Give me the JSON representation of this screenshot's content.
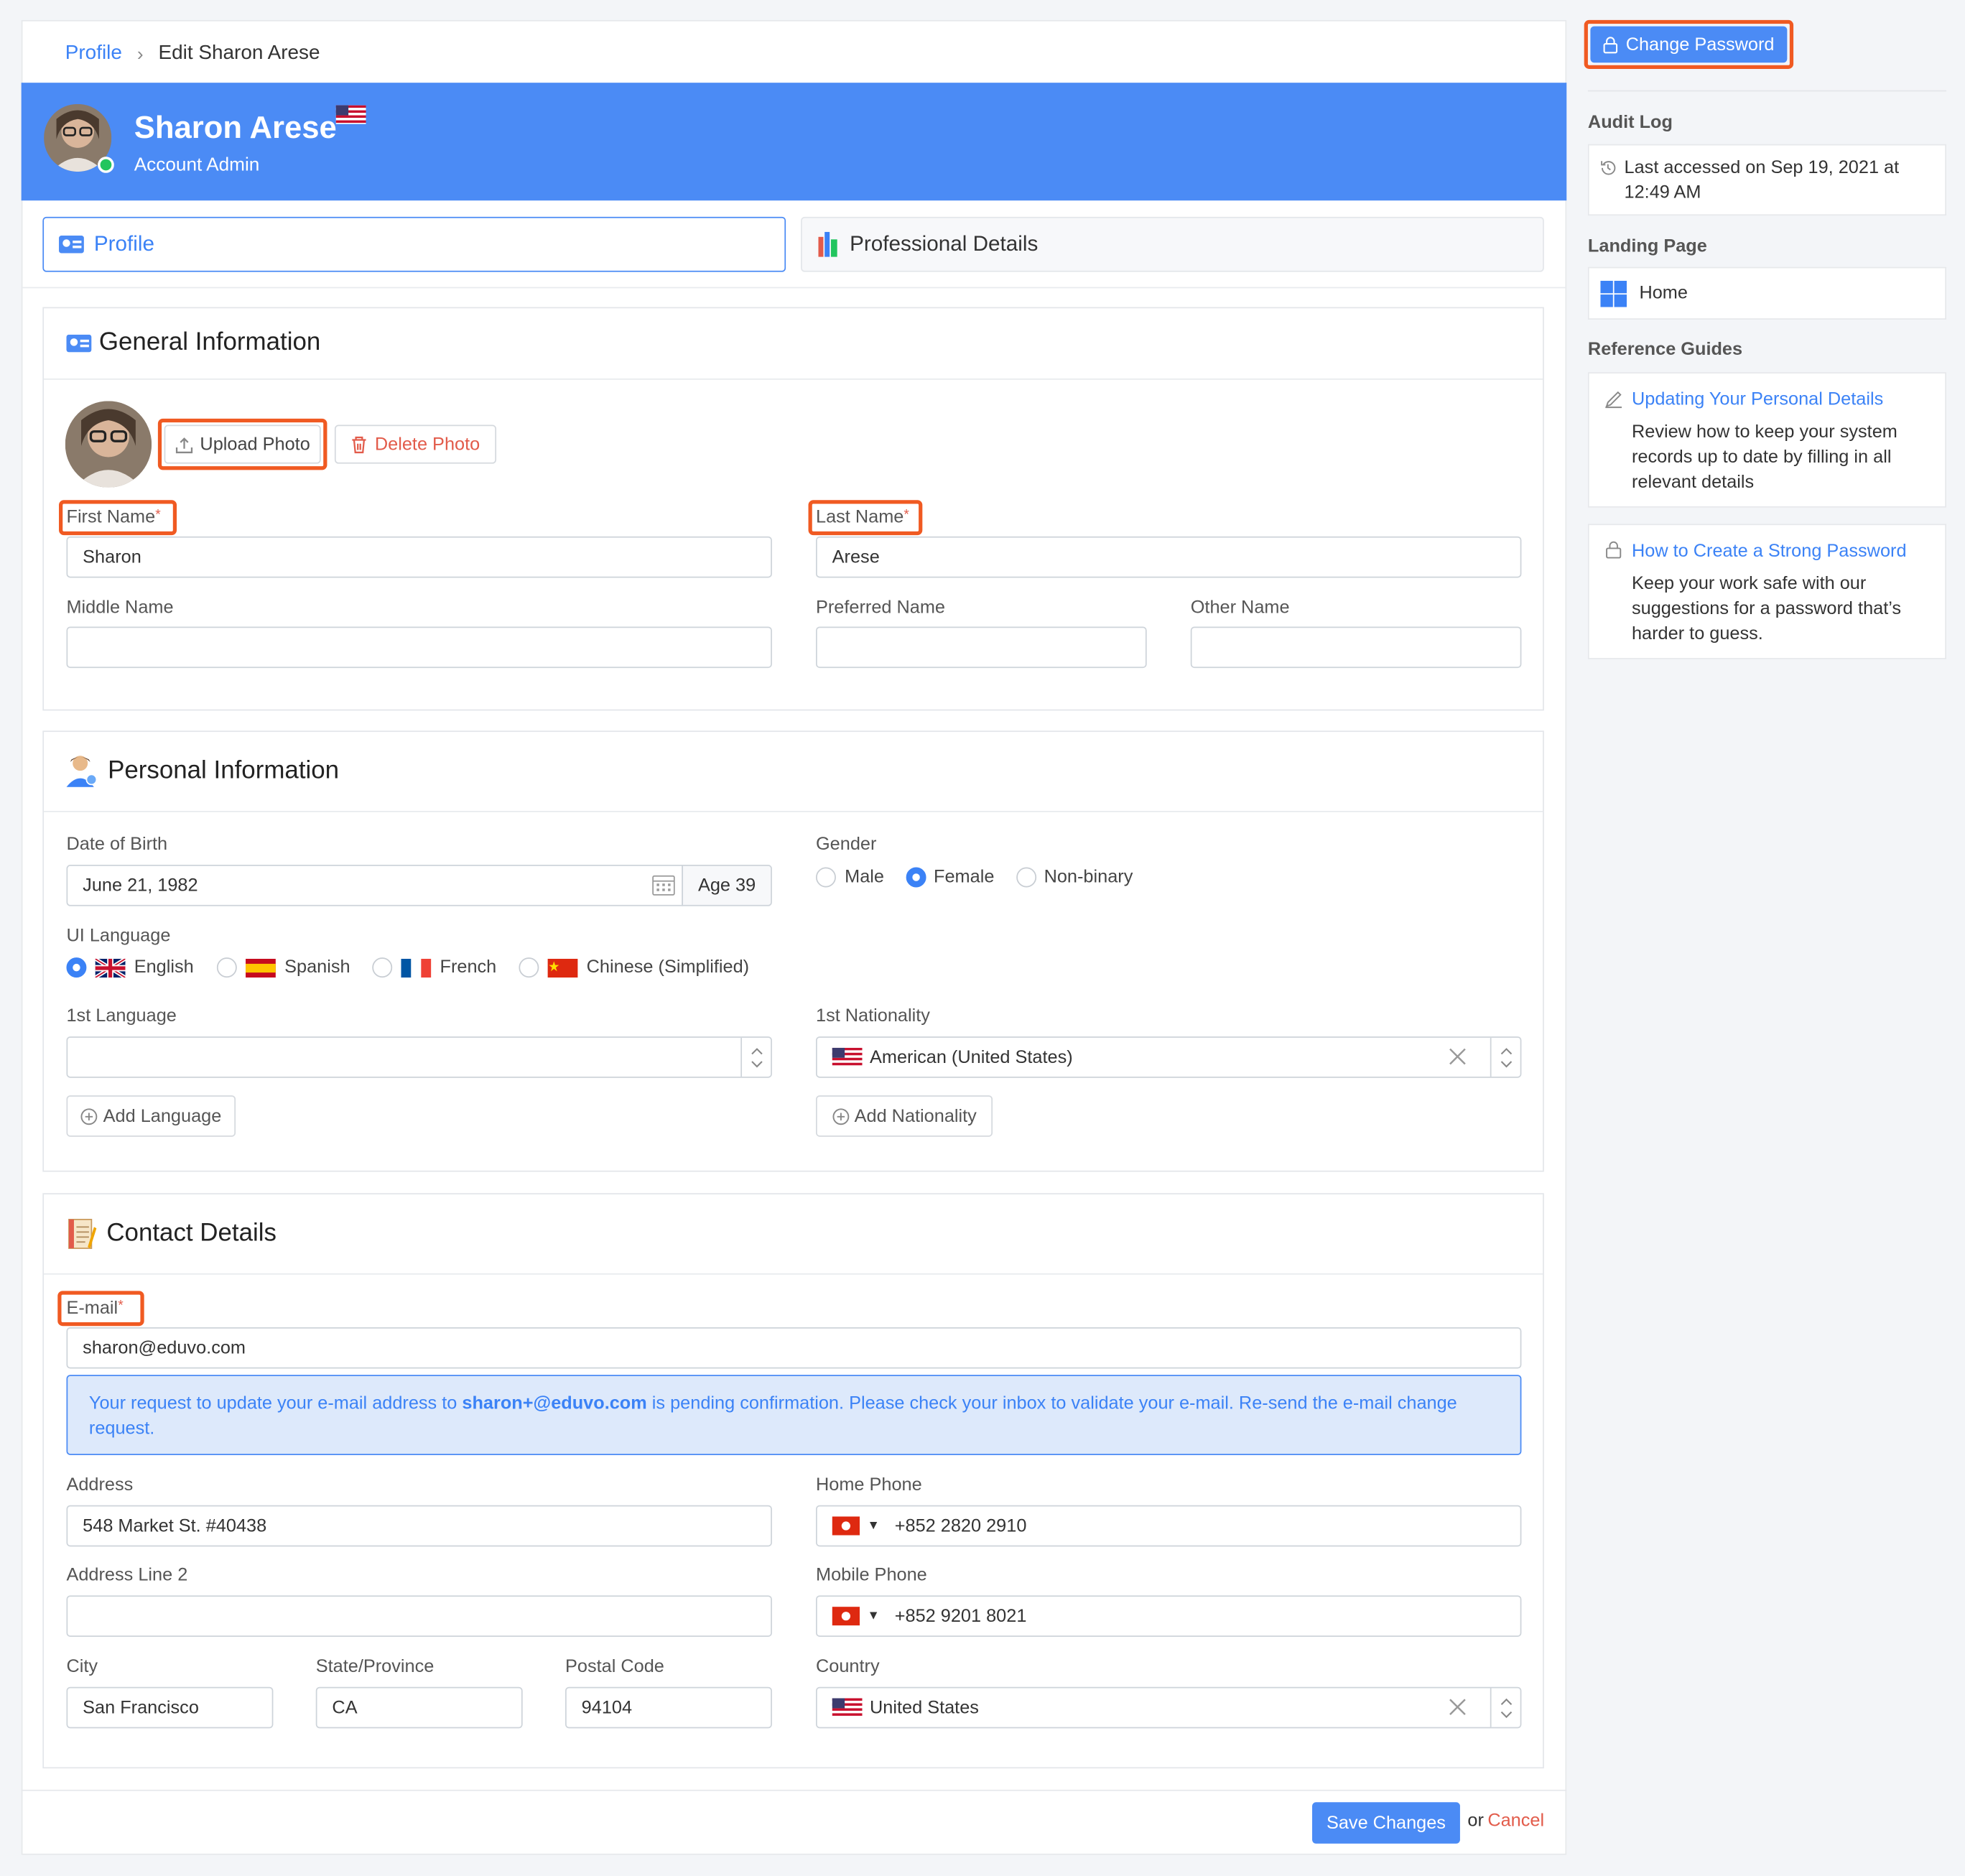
{
  "breadcrumb": {
    "parent": "Profile",
    "separator": "›",
    "current": "Edit Sharon Arese"
  },
  "header": {
    "name": "Sharon Arese",
    "role": "Account Admin"
  },
  "tabs": [
    {
      "label": "Profile"
    },
    {
      "label": "Professional Details"
    }
  ],
  "general": {
    "title": "General Information",
    "upload_photo": "Upload Photo",
    "delete_photo": "Delete Photo",
    "first_name_label": "First Name",
    "first_name_value": "Sharon",
    "last_name_label": "Last Name",
    "last_name_value": "Arese",
    "middle_name_label": "Middle Name",
    "preferred_name_label": "Preferred Name",
    "other_name_label": "Other Name",
    "required_mark": "*"
  },
  "personal": {
    "title": "Personal Information",
    "dob_label": "Date of Birth",
    "dob_value": "June 21, 1982",
    "age": "Age 39",
    "gender_label": "Gender",
    "gender_options": [
      "Male",
      "Female",
      "Non-binary"
    ],
    "gender_selected": "Female",
    "ui_language_label": "UI Language",
    "ui_languages": [
      "English",
      "Spanish",
      "French",
      "Chinese (Simplified)"
    ],
    "ui_language_selected": "English",
    "first_language_label": "1st Language",
    "first_nationality_label": "1st Nationality",
    "first_nationality_value": "American (United States)",
    "add_language": "Add Language",
    "add_nationality": "Add Nationality"
  },
  "contact": {
    "title": "Contact Details",
    "email_label": "E-mail",
    "email_value": "sharon@eduvo.com",
    "notice_pre": "Your request to update your e-mail address to ",
    "notice_email": "sharon+@eduvo.com",
    "notice_post": " is pending confirmation. Please check your inbox to validate your e-mail. Re-send the e-mail change",
    "notice_line2": "request.",
    "address_label": "Address",
    "address_value": "548 Market St. #40438",
    "address2_label": "Address Line 2",
    "home_phone_label": "Home Phone",
    "home_phone_value": "+852 2820 2910",
    "mobile_phone_label": "Mobile Phone",
    "mobile_phone_value": "+852 9201 8021",
    "city_label": "City",
    "city_value": "San Francisco",
    "state_label": "State/Province",
    "state_value": "CA",
    "postal_label": "Postal Code",
    "postal_value": "94104",
    "country_label": "Country",
    "country_value": "United States"
  },
  "footer": {
    "save": "Save Changes",
    "or": "or",
    "cancel": "Cancel"
  },
  "sidebar": {
    "change_password": "Change Password",
    "audit_log_label": "Audit Log",
    "audit_line1": "Last accessed on Sep 19, 2021 at",
    "audit_line2": "12:49 AM",
    "landing_label": "Landing Page",
    "landing_value": "Home",
    "guides_label": "Reference Guides",
    "guides": [
      {
        "title": "Updating Your Personal Details",
        "lines": [
          "Review how to keep your system",
          "records up to date by filling in all",
          "relevant details"
        ]
      },
      {
        "title": "How to Create a Strong Password",
        "lines": [
          "Keep your work safe with our",
          "suggestions for a password that’s",
          "harder to guess."
        ]
      }
    ]
  },
  "colors": {
    "accent": "#4b8bf5",
    "highlight": "#f05a22",
    "danger": "#e25b4a",
    "link": "#3b82f6"
  }
}
